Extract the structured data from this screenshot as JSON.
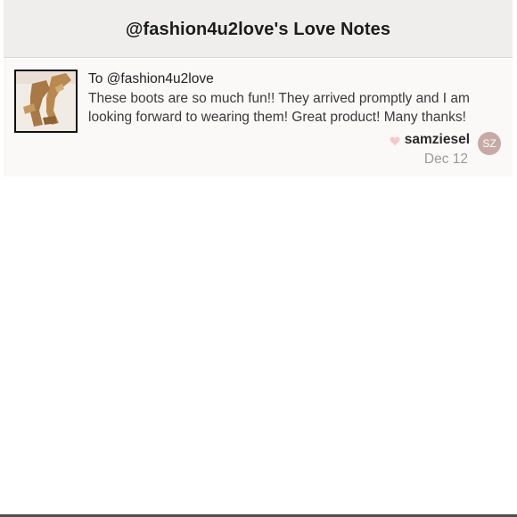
{
  "header": {
    "title": "@fashion4u2love's Love Notes"
  },
  "note": {
    "to_label": "To @fashion4u2love",
    "message": "These boots are so much fun!! They arrived promptly and I am looking forward to wearing them! Great product! Many thanks!",
    "sender": "samziesel",
    "avatar_initials": "SZ",
    "date": "Dec 12",
    "thumbnail_icon": "boots-photo",
    "heart_icon": "heart-icon",
    "colors": {
      "header_bg": "#f0eeec",
      "card_bg": "#fbf8f8",
      "heart": "#f6c9c9",
      "avatar_bg": "#c7a9a6"
    }
  }
}
